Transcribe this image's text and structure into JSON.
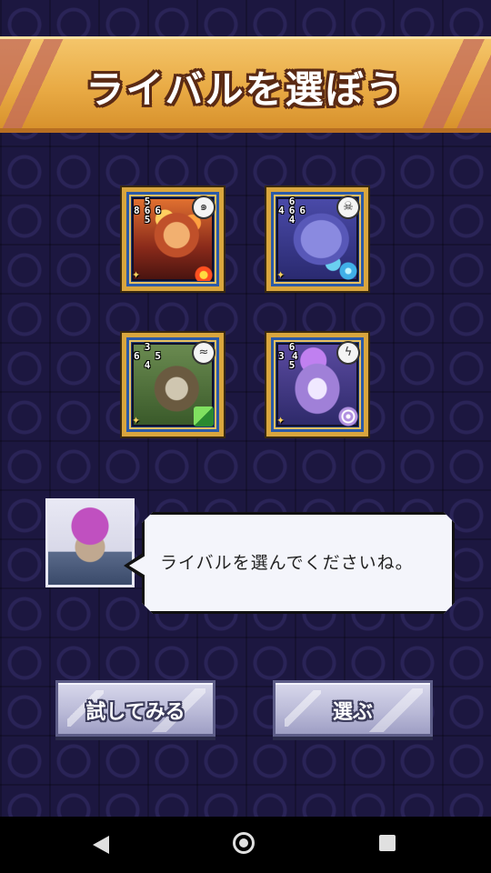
{
  "header": {
    "title": "ライバルを選ぼう"
  },
  "cards": [
    {
      "stats": {
        "top": "5",
        "left": "8",
        "mid": "6",
        "right": "6",
        "bottom": "5"
      },
      "element_icon": "swirl-icon",
      "element_glyph": "๑"
    },
    {
      "stats": {
        "top": "6",
        "left": "4",
        "mid": "6",
        "right": "6",
        "bottom": "4"
      },
      "element_icon": "skull-icon",
      "element_glyph": "☠"
    },
    {
      "stats": {
        "top": "3",
        "left": "6",
        "mid": "",
        "right": "5",
        "bottom": "4"
      },
      "element_icon": "wave-icon",
      "element_glyph": "≈"
    },
    {
      "stats": {
        "top": "6",
        "left": "3",
        "mid": "4",
        "right": "",
        "bottom": "5"
      },
      "element_icon": "lightning-icon",
      "element_glyph": "ϟ"
    }
  ],
  "dialog": {
    "message": "ライバルを選んでくださいね。"
  },
  "buttons": {
    "try": "試してみる",
    "select": "選ぶ"
  },
  "colors": {
    "banner": "#e9ab45",
    "background": "#1c1740",
    "card_frame": "#d9a63e"
  }
}
